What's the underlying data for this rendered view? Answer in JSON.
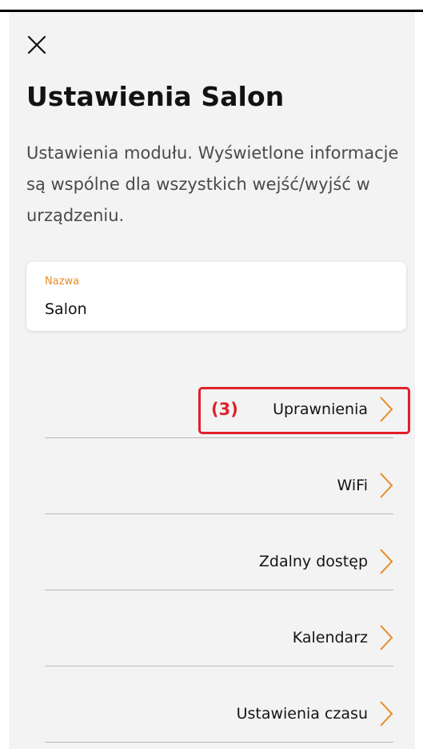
{
  "page": {
    "title": "Ustawienia Salon",
    "description": "Ustawienia modułu. Wyświetlone informacje są wspólne dla wszystkich wejść/wyjść w urządzeniu."
  },
  "name_field": {
    "label": "Nazwa",
    "value": "Salon"
  },
  "menu": {
    "items": [
      {
        "label": "Uprawnienia"
      },
      {
        "label": "WiFi"
      },
      {
        "label": "Zdalny dostęp"
      },
      {
        "label": "Kalendarz"
      },
      {
        "label": "Ustawienia czasu"
      }
    ]
  },
  "annotation": {
    "number": "(3)",
    "color": "#e0202b"
  },
  "colors": {
    "accent": "#e98b22",
    "background": "#f3f3f3",
    "highlight": "#e0202b"
  },
  "icons": {
    "close": "close-icon",
    "chevron": "chevron-right-icon"
  }
}
